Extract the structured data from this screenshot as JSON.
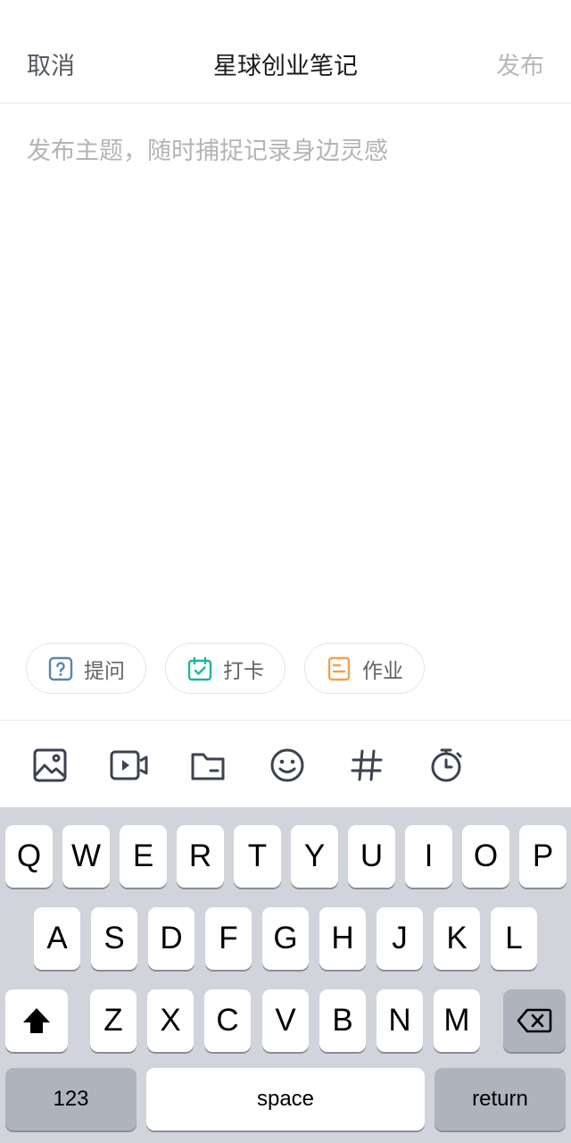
{
  "header": {
    "cancel": "取消",
    "title": "星球创业笔记",
    "publish": "发布"
  },
  "editor": {
    "placeholder": "发布主题，随时捕捉记录身边灵感"
  },
  "chips": [
    {
      "label": "提问",
      "icon": "question-icon",
      "color": "#5b84a8"
    },
    {
      "label": "打卡",
      "icon": "calendar-check-icon",
      "color": "#1fb59a"
    },
    {
      "label": "作业",
      "icon": "homework-doc-icon",
      "color": "#f5a04a"
    }
  ],
  "toolbar": {
    "icons": [
      "image-icon",
      "video-icon",
      "folder-icon",
      "emoji-icon",
      "hashtag-icon",
      "timer-icon"
    ]
  },
  "keyboard": {
    "row1": [
      "Q",
      "W",
      "E",
      "R",
      "T",
      "Y",
      "U",
      "I",
      "O",
      "P"
    ],
    "row2": [
      "A",
      "S",
      "D",
      "F",
      "G",
      "H",
      "J",
      "K",
      "L"
    ],
    "row3": [
      "Z",
      "X",
      "C",
      "V",
      "B",
      "N",
      "M"
    ],
    "numbers": "123",
    "space": "space",
    "return": "return",
    "shift_icon": "shift-icon",
    "delete_icon": "backspace-icon"
  }
}
